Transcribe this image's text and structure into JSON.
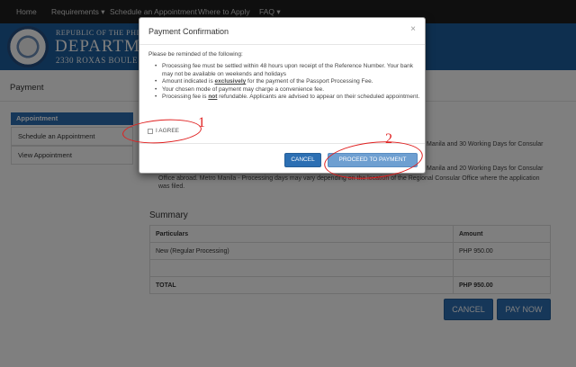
{
  "nav": {
    "items": [
      "Home",
      "Requirements ▾",
      "Schedule an Appointment",
      "Where to Apply",
      "FAQ ▾"
    ]
  },
  "banner": {
    "line1": "REPUBLIC OF THE PHIL",
    "line2": "DEPARTME",
    "line3": "2330 ROXAS BOULE"
  },
  "page": {
    "title": "Payment"
  },
  "sidebar": {
    "heading": "Appointment",
    "items": [
      "Schedule an Appointment",
      "View Appointment"
    ]
  },
  "background_text": {
    "row1_right": "Manila and 30 Working Days for Consular",
    "row2_right": "Manila and 20 Working Days for Consular",
    "row3_a": "Office abroad. Metro Manila - Processing days may vary depending",
    "row3_red": "on the location",
    "row3_b": "of the Regional Consular Office where the application",
    "row4": "was filed."
  },
  "summary": {
    "title": "Summary",
    "headers": [
      "Particulars",
      "Amount"
    ],
    "rows": [
      {
        "particular": "New (Regular Processing)",
        "amount": "PHP 950.00"
      },
      {
        "particular": "",
        "amount": ""
      },
      {
        "particular": "TOTAL",
        "amount": "PHP 950.00"
      }
    ]
  },
  "page_buttons": {
    "cancel": "CANCEL",
    "pay_now": "PAY NOW"
  },
  "modal": {
    "title": "Payment Confirmation",
    "close": "×",
    "intro": "Please be reminded of the following:",
    "notes": [
      {
        "pre": "Processing fee must be settled within 48 hours upon receipt of the Reference Number. Your bank may not be available on weekends and holidays",
        "em": "",
        "post": ""
      },
      {
        "pre": "Amount indicated is ",
        "em": "exclusively",
        "post": " for the payment of the Passport Processing Fee."
      },
      {
        "pre": "Your chosen mode of payment may charge a convenience fee.",
        "em": "",
        "post": ""
      },
      {
        "pre": "Processing fee is ",
        "em": "not",
        "post": " refundable. Applicants are advised to appear on their scheduled appointment."
      }
    ],
    "agree_label": "I AGREE",
    "cancel_label": "CANCEL",
    "proceed_label": "PROCEED TO PAYMENT"
  },
  "annotations": {
    "num1": "1",
    "num2": "2"
  }
}
